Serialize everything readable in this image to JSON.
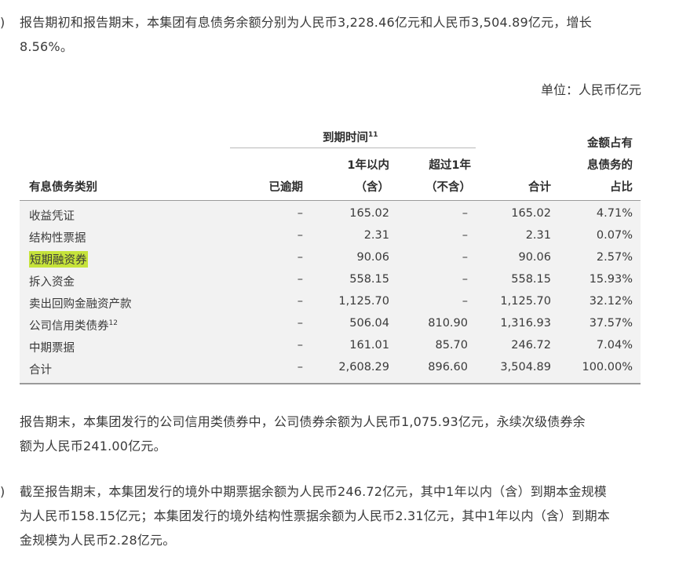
{
  "para1": {
    "bracket": ")",
    "line1": "报告期初和报告期末，本集团有息债务余额分别为人民币3,228.46亿元和人民币3,504.89亿元，增长",
    "line2": "8.56%。"
  },
  "unit": "单位：人民币亿元",
  "table": {
    "group_header": "到期时间",
    "group_header_sup": "11",
    "headers": {
      "category": "有息债务类别",
      "overdue": "已逾期",
      "within1_a": "1年以内",
      "within1_b": "（含）",
      "over1_a": "超过1年",
      "over1_b": "（不含）",
      "total": "合计",
      "ratio_a": "金额占有",
      "ratio_b": "息债务的",
      "ratio_c": "占比"
    },
    "rows": [
      {
        "category": "收益凭证",
        "sup": "",
        "overdue": "–",
        "within1": "165.02",
        "over1": "–",
        "total": "165.02",
        "ratio": "4.71%"
      },
      {
        "category": "结构性票据",
        "sup": "",
        "overdue": "–",
        "within1": "2.31",
        "over1": "–",
        "total": "2.31",
        "ratio": "0.07%"
      },
      {
        "category": "短期融资券",
        "sup": "",
        "overdue": "–",
        "within1": "90.06",
        "over1": "–",
        "total": "90.06",
        "ratio": "2.57%"
      },
      {
        "category": "拆入资金",
        "sup": "",
        "overdue": "–",
        "within1": "558.15",
        "over1": "–",
        "total": "558.15",
        "ratio": "15.93%"
      },
      {
        "category": "卖出回购金融资产款",
        "sup": "",
        "overdue": "–",
        "within1": "1,125.70",
        "over1": "–",
        "total": "1,125.70",
        "ratio": "32.12%"
      },
      {
        "category": "公司信用类债券",
        "sup": "12",
        "overdue": "–",
        "within1": "506.04",
        "over1": "810.90",
        "total": "1,316.93",
        "ratio": "37.57%"
      },
      {
        "category": "中期票据",
        "sup": "",
        "overdue": "–",
        "within1": "161.01",
        "over1": "85.70",
        "total": "246.72",
        "ratio": "7.04%"
      },
      {
        "category": "合计",
        "sup": "",
        "overdue": "–",
        "within1": "2,608.29",
        "over1": "896.60",
        "total": "3,504.89",
        "ratio": "100.00%"
      }
    ]
  },
  "para2": {
    "line1": "报告期末，本集团发行的公司信用类债券中，公司债券余额为人民币1,075.93亿元，永续次级债券余",
    "line2": "额为人民币241.00亿元。"
  },
  "para3": {
    "bracket": ")",
    "line1": "截至报告期末，本集团发行的境外中期票据余额为人民币246.72亿元，其中1年以内（含）到期本金规模",
    "line2": "为人民币158.15亿元；本集团发行的境外结构性票据余额为人民币2.31亿元，其中1年以内（含）到期本",
    "line3": "金规模为人民币2.28亿元。"
  },
  "colors": {
    "highlight": "#c6e33b",
    "table_bg": "#f2f2f2",
    "text": "#3a3a3a"
  }
}
